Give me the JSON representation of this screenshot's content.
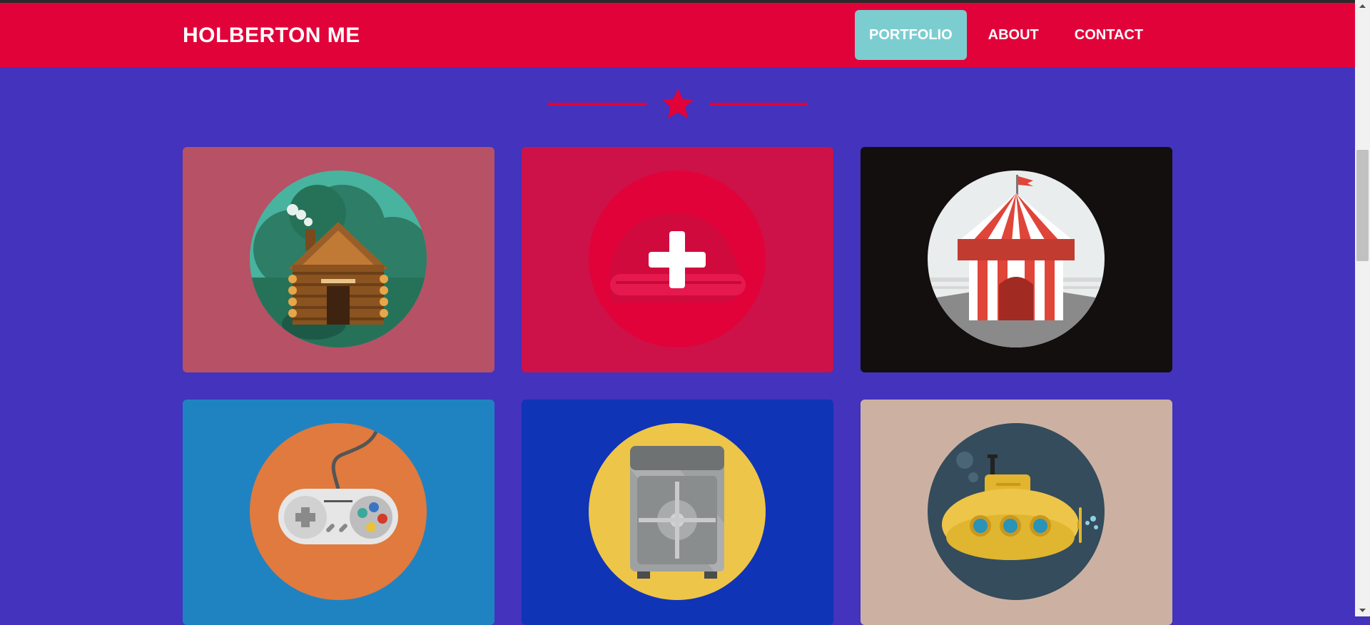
{
  "navbar": {
    "brand": "HOLBERTON ME",
    "items": [
      {
        "label": "PORTFOLIO",
        "active": true
      },
      {
        "label": "ABOUT",
        "active": false
      },
      {
        "label": "CONTACT",
        "active": false
      }
    ]
  },
  "colors": {
    "page_background": "#4333bd",
    "navbar": "#e1023a",
    "active_nav": "#7ccdd0",
    "divider": "#e1023a"
  },
  "divider": {
    "icon": "star-icon"
  },
  "portfolio": {
    "items": [
      {
        "icon": "log-cabin-icon",
        "background": "#b75165",
        "circle": "#48b39e"
      },
      {
        "icon": "add-overlay-plus-icon",
        "background": "#cc1248",
        "circle": "#e1023a",
        "hovered": true
      },
      {
        "icon": "circus-tent-icon",
        "background": "#130f0e",
        "circle": "#e9eded"
      },
      {
        "icon": "game-controller-icon",
        "background": "#1f83c2",
        "circle": "#e07a3e"
      },
      {
        "icon": "safe-icon",
        "background": "#1034b6",
        "circle": "#edc548"
      },
      {
        "icon": "submarine-icon",
        "background": "#ccb1a2",
        "circle": "#344c5c"
      }
    ]
  }
}
